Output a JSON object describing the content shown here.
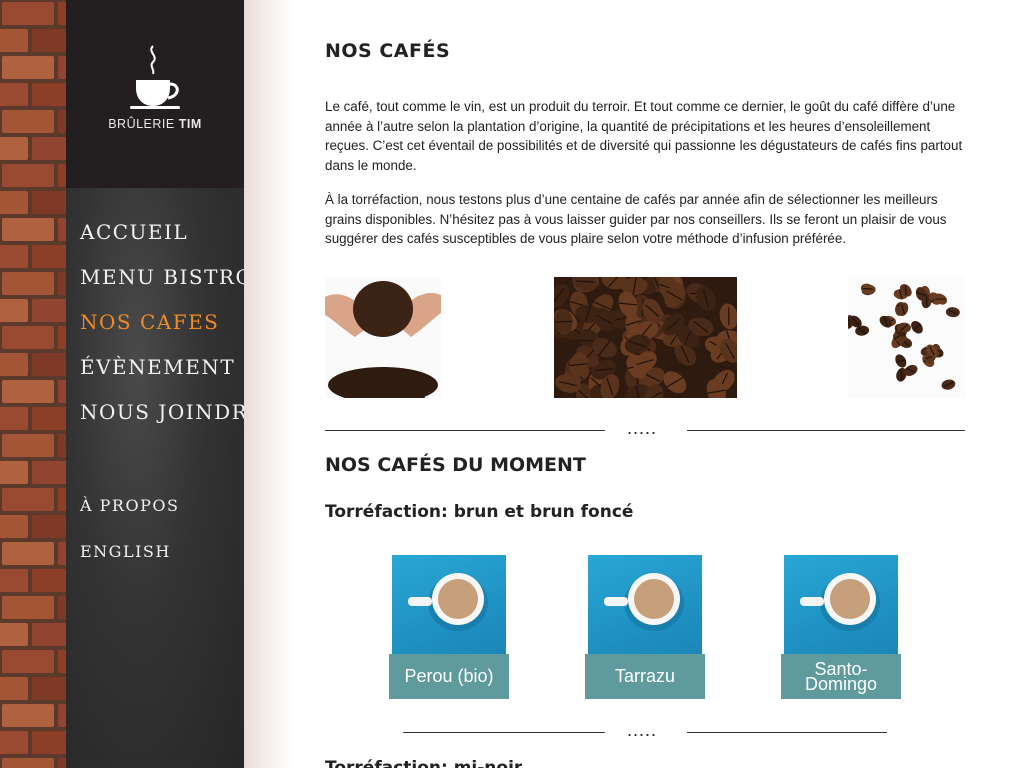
{
  "brand": {
    "name_light": "BRÛLERIE",
    "name_bold": "TIM"
  },
  "nav": {
    "items": [
      {
        "label": "ACCUEIL",
        "active": false
      },
      {
        "label": "MENU BISTRO",
        "active": false
      },
      {
        "label": "NOS CAFES",
        "active": true
      },
      {
        "label": "ÉVÈNEMENT",
        "active": false
      },
      {
        "label": "NOUS JOINDRE",
        "active": false
      }
    ],
    "secondary": [
      {
        "label": "À PROPOS"
      },
      {
        "label": "ENGLISH"
      }
    ],
    "active_color": "#f08a25"
  },
  "main": {
    "title": "NOS CAFÉS",
    "paragraphs": [
      "Le café, tout comme le vin, est un produit du terroir. Et tout comme ce dernier, le goût du café diffère d’une année à l’autre selon la plantation d’origine, la quantité de précipitations et les heures d’ensoleillement reçues. C’est cet éventail de possibilités et de diversité qui passionne les dégustateurs de cafés fins partout dans le monde.",
      "À la torréfaction, nous testons plus d’une centaine de cafés par année afin de sélectionner les meilleurs grains disponibles. N’hésitez pas à vous laisser guider par nos conseillers. Ils se feront un plaisir de vous suggérer des cafés susceptibles de vous plaire selon votre méthode d’infusion préférée."
    ],
    "divider_dots": ".....",
    "moment_title": "NOS CAFÉS DU MOMENT",
    "roast_title": "Torréfaction: brun et brun foncé",
    "coffees": [
      {
        "name": "Perou (bio)"
      },
      {
        "name": "Tarrazu"
      },
      {
        "name": "Santo-Domingo"
      }
    ],
    "next_roast_title": "Torréfaction: mi-noir"
  },
  "colors": {
    "sidebar": "#2b2b2b",
    "card_label": "#5f9a9c",
    "accent": "#f08a25"
  }
}
